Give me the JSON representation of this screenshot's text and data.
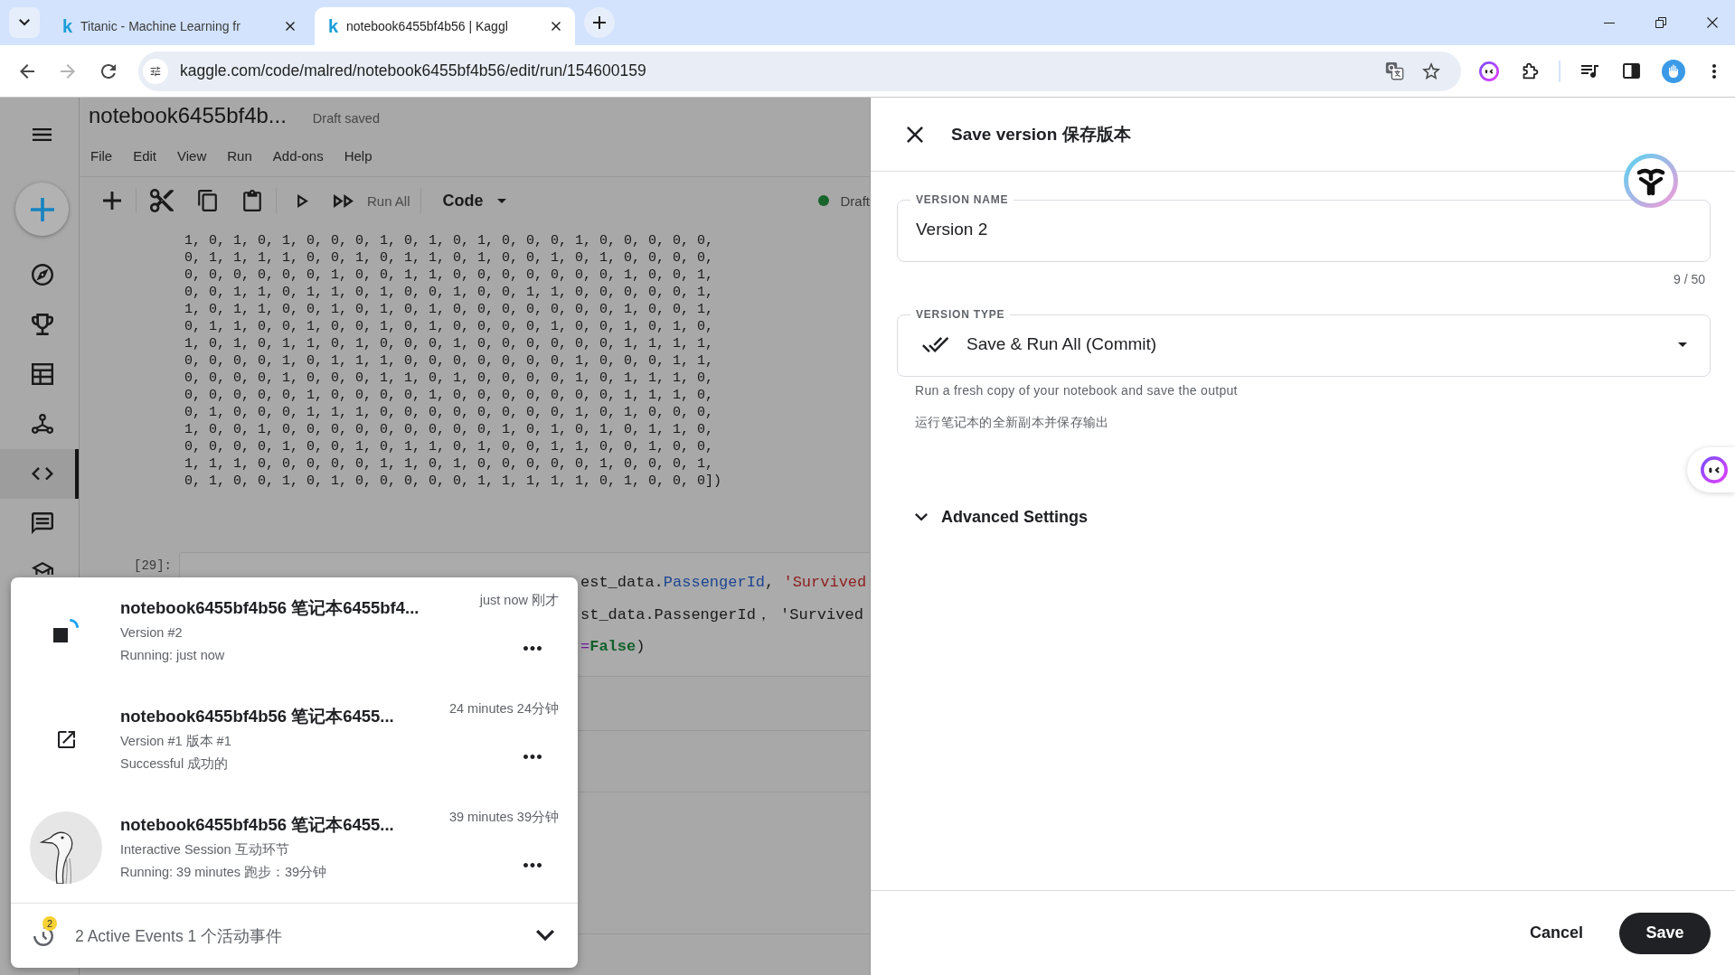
{
  "browser": {
    "tabs": [
      {
        "favicon": "k",
        "title": "Titanic - Machine Learning fr",
        "selected": false
      },
      {
        "favicon": "k",
        "title": "notebook6455bf4b56 | Kaggl",
        "selected": true
      }
    ],
    "nav": [
      {
        "kind": "back",
        "disabled": false
      },
      {
        "kind": "forward",
        "disabled": true
      },
      {
        "kind": "reload",
        "disabled": false
      }
    ],
    "url": "kaggle.com/code/malred/notebook6455bf4b56/edit/run/154600159"
  },
  "notebook": {
    "sidebar": [
      {
        "kind": "compass",
        "selected": false
      },
      {
        "kind": "trophy",
        "selected": false
      },
      {
        "kind": "table",
        "selected": false
      },
      {
        "kind": "models",
        "selected": false
      },
      {
        "kind": "code",
        "selected": true
      },
      {
        "kind": "comments",
        "selected": false
      },
      {
        "kind": "school",
        "selected": false
      }
    ],
    "title": "notebook6455bf4b...",
    "save_status": "Draft saved",
    "menu": [
      "File",
      "Edit",
      "View",
      "Run",
      "Add-ons",
      "Help"
    ],
    "toolbar": {
      "run_all": "Run All",
      "cell_type": "Code",
      "session": "Draft"
    },
    "output_lines": [
      "1, 0, 1, 0, 1, 0, 0, 0, 1, 0, 1, 0, 1, 0, 0, 0, 1, 0, 0, 0, 0, 0,",
      "0, 1, 1, 1, 1, 0, 0, 1, 0, 1, 1, 0, 1, 0, 0, 1, 0, 1, 0, 0, 0, 0,",
      "0, 0, 0, 0, 0, 0, 1, 0, 0, 1, 1, 0, 0, 0, 0, 0, 0, 0, 1, 0, 0, 1,",
      "0, 0, 1, 1, 0, 1, 1, 0, 1, 0, 0, 1, 0, 0, 1, 1, 0, 0, 0, 0, 0, 1,",
      "1, 0, 1, 1, 0, 0, 1, 0, 1, 0, 1, 0, 0, 0, 0, 0, 0, 0, 1, 0, 0, 1,",
      "0, 1, 1, 0, 0, 1, 0, 0, 1, 0, 1, 0, 0, 0, 0, 1, 0, 0, 1, 0, 1, 0,",
      "1, 0, 1, 0, 1, 1, 0, 1, 0, 0, 0, 1, 0, 0, 0, 0, 0, 0, 1, 1, 1, 1,",
      "0, 0, 0, 0, 1, 0, 1, 1, 1, 0, 0, 0, 0, 0, 0, 0, 1, 0, 0, 0, 1, 1,",
      "0, 0, 0, 0, 1, 0, 0, 0, 1, 1, 0, 1, 0, 0, 0, 0, 1, 0, 1, 1, 1, 0,",
      "0, 0, 0, 0, 0, 1, 0, 0, 0, 0, 1, 0, 0, 0, 0, 0, 0, 0, 1, 1, 1, 0,",
      "0, 1, 0, 0, 0, 1, 1, 1, 0, 0, 0, 0, 0, 0, 0, 0, 1, 0, 1, 0, 0, 0,",
      "1, 0, 0, 1, 0, 0, 0, 0, 0, 0, 0, 0, 0, 1, 0, 1, 0, 1, 0, 1, 1, 0,",
      "0, 0, 0, 0, 1, 0, 0, 1, 0, 1, 1, 0, 1, 0, 0, 1, 1, 0, 0, 1, 0, 0,",
      "1, 1, 1, 0, 0, 0, 0, 0, 1, 1, 0, 1, 0, 0, 0, 0, 0, 1, 0, 0, 0, 1,",
      "0, 1, 0, 0, 1, 0, 1, 0, 0, 0, 0, 0, 1, 1, 1, 1, 1, 0, 1, 0, 0, 0])"
    ],
    "cell": {
      "prompt": "[29]:",
      "lines": [
        [
          {
            "kind": "plain",
            "text": "est_data."
          },
          {
            "kind": "attr",
            "text": "PassengerId"
          },
          {
            "kind": "plain",
            "text": ", "
          },
          {
            "kind": "string",
            "text": "'Survived"
          }
        ],
        [
          {
            "kind": "plain",
            "text": "st_data.PassengerId， 'Survived"
          }
        ],
        [
          {
            "kind": "op",
            "text": "="
          },
          {
            "kind": "keyword",
            "text": "False"
          },
          {
            "kind": "plain",
            "text": ")"
          }
        ]
      ]
    }
  },
  "events": {
    "items": [
      {
        "kind": "running",
        "title": "notebook6455bf4b56 笔记本6455bf4...",
        "time": "just now 刚才",
        "details": [
          "Version #2",
          "Running: just now"
        ]
      },
      {
        "kind": "version",
        "title": "notebook6455bf4b56 笔记本6455...",
        "time": "24 minutes 24分钟",
        "details": [
          "Version #1 版本 #1",
          "Successful 成功的"
        ]
      },
      {
        "kind": "session",
        "title": "notebook6455bf4b56 笔记本6455...",
        "time": "39 minutes 39分钟",
        "details": [
          "Interactive Session 互动环节",
          "Running: 39 minutes 跑步：39分钟"
        ]
      }
    ],
    "badge": "2",
    "summary": "2 Active Events 1 个活动事件"
  },
  "save_panel": {
    "title": "Save version 保存版本",
    "name_field": {
      "label": "VERSION NAME",
      "value": "Version 2",
      "counter": "9 / 50"
    },
    "type_field": {
      "label": "VERSION TYPE",
      "value": "Save & Run All (Commit)",
      "help": [
        "Run a fresh copy of your notebook and save the output",
        "运行笔记本的全新副本并保存输出"
      ]
    },
    "advanced": {
      "label": "Advanced Settings",
      "expanded": false
    },
    "buttons": [
      {
        "kind": "cancel",
        "label": "Cancel"
      },
      {
        "kind": "submit",
        "label": "Save"
      }
    ]
  }
}
